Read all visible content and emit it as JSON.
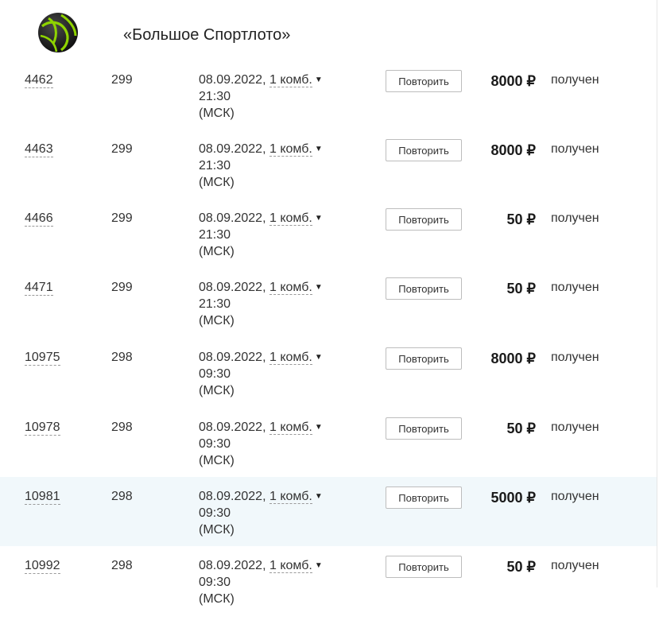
{
  "game": {
    "title": "«Большое Спортлото»",
    "logo_icon": "sportloto-ball-icon",
    "logo_colors": [
      "#1f1f1f",
      "#8fd400"
    ]
  },
  "colors": {
    "highlight_row": "#f1f8fb",
    "border": "#bdbdbd"
  },
  "rows": [
    {
      "ticket": "4462",
      "draw": "299",
      "date": "08.09.2022,",
      "combo": "1 комб.",
      "time": "21:30",
      "tz": "(МСК)",
      "button": "Повторить",
      "prize": "8000 ₽",
      "status": "получен"
    },
    {
      "ticket": "4463",
      "draw": "299",
      "date": "08.09.2022,",
      "combo": "1 комб.",
      "time": "21:30",
      "tz": "(МСК)",
      "button": "Повторить",
      "prize": "8000 ₽",
      "status": "получен"
    },
    {
      "ticket": "4466",
      "draw": "299",
      "date": "08.09.2022,",
      "combo": "1 комб.",
      "time": "21:30",
      "tz": "(МСК)",
      "button": "Повторить",
      "prize": "50 ₽",
      "status": "получен"
    },
    {
      "ticket": "4471",
      "draw": "299",
      "date": "08.09.2022,",
      "combo": "1 комб.",
      "time": "21:30",
      "tz": "(МСК)",
      "button": "Повторить",
      "prize": "50 ₽",
      "status": "получен"
    },
    {
      "ticket": "10975",
      "draw": "298",
      "date": "08.09.2022,",
      "combo": "1 комб.",
      "time": "09:30",
      "tz": "(МСК)",
      "button": "Повторить",
      "prize": "8000 ₽",
      "status": "получен"
    },
    {
      "ticket": "10978",
      "draw": "298",
      "date": "08.09.2022,",
      "combo": "1 комб.",
      "time": "09:30",
      "tz": "(МСК)",
      "button": "Повторить",
      "prize": "50 ₽",
      "status": "получен"
    },
    {
      "ticket": "10981",
      "draw": "298",
      "date": "08.09.2022,",
      "combo": "1 комб.",
      "time": "09:30",
      "tz": "(МСК)",
      "button": "Повторить",
      "prize": "5000 ₽",
      "status": "получен",
      "highlighted": true
    },
    {
      "ticket": "10992",
      "draw": "298",
      "date": "08.09.2022,",
      "combo": "1 комб.",
      "time": "09:30",
      "tz": "(МСК)",
      "button": "Повторить",
      "prize": "50 ₽",
      "status": "получен"
    }
  ]
}
